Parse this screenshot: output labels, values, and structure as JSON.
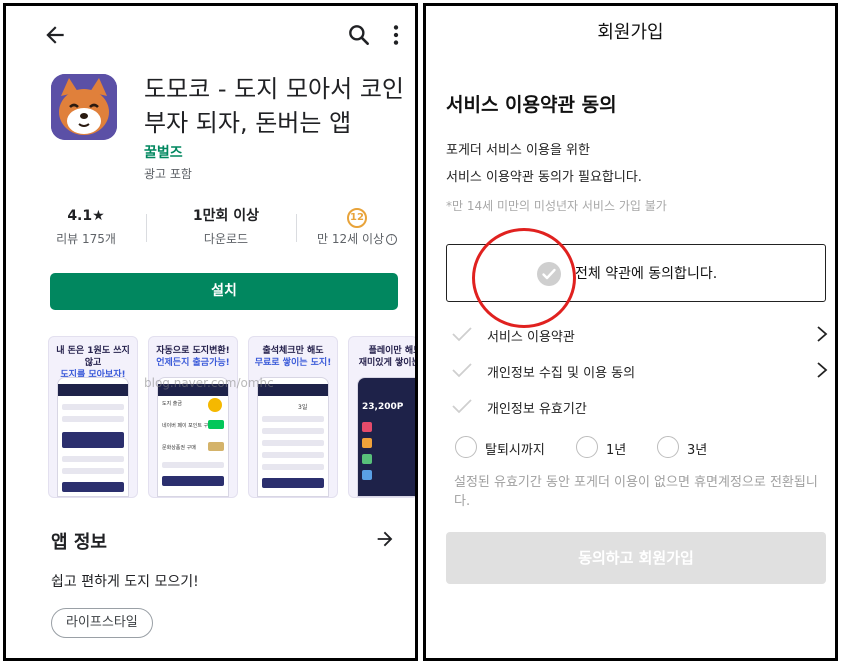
{
  "playstore": {
    "app_title": "도모코 - 도지 모아서 코인 부자 되자, 돈버는 앱",
    "developer": "꿀벌즈",
    "ad_note": "광고 포함",
    "stats": {
      "rating": "4.1★",
      "reviews": "리뷰 175개",
      "downloads": "1만회 이상",
      "downloads_label": "다운로드",
      "age_badge": "12",
      "age_label": "만 12세 이상"
    },
    "install_label": "설치",
    "screenshots": [
      {
        "caption_a": "내 돈은 1원도 쓰지않고",
        "caption_b": "도지를 모아보자!"
      },
      {
        "caption_a": "자동으로 도지변환!",
        "caption_b": "언제든지 출금가능!"
      },
      {
        "caption_a": "출석체크만 해도",
        "caption_b": "무료로 쌓이는 도지!"
      },
      {
        "caption_a": "플레이만 해도",
        "caption_b": "재미있게 쌓이는 도"
      }
    ],
    "screen_text": {
      "shot2_line1": "도지 출금",
      "shot2_line2": "네이버 페이 포인트 구매",
      "shot2_line3": "문화상품권 구매",
      "shot3_days": "3일",
      "shot4_amount": "23,200P"
    },
    "watermark": "blog.naver.com/omhc",
    "info_title": "앱 정보",
    "info_desc": "쉽고 편하게 도지 모으기!",
    "tag": "라이프스타일"
  },
  "signup": {
    "title": "회원가입",
    "heading": "서비스 이용약관 동의",
    "desc_line1": "포게더 서비스 이용을 위한",
    "desc_line2": "서비스 이용약관 동의가 필요합니다.",
    "age_note": "*만 14세 미만의 미성년자 서비스 가입 불가",
    "agree_all": "전체 약관에 동의합니다.",
    "terms": [
      {
        "label": "서비스 이용약관"
      },
      {
        "label": "개인정보 수집 및 이용 동의"
      },
      {
        "label": "개인정보 유효기간"
      }
    ],
    "retention_options": [
      "탈퇴시까지",
      "1년",
      "3년"
    ],
    "expire_note": "설정된 유효기간 동안 포게더 이용이 없으면 휴면계정으로 전환됩니다.",
    "submit_label": "동의하고 회원가입"
  },
  "colors": {
    "install_green": "#01875f",
    "highlight_red": "#e0211f",
    "disabled_button": "#e0e0e0",
    "app_icon_bg": "#5b50a6"
  },
  "icons": [
    "back-arrow-icon",
    "search-icon",
    "more-vert-icon",
    "arrow-right-icon",
    "check-circle-icon",
    "check-icon",
    "chevron-right-icon",
    "info-icon"
  ]
}
